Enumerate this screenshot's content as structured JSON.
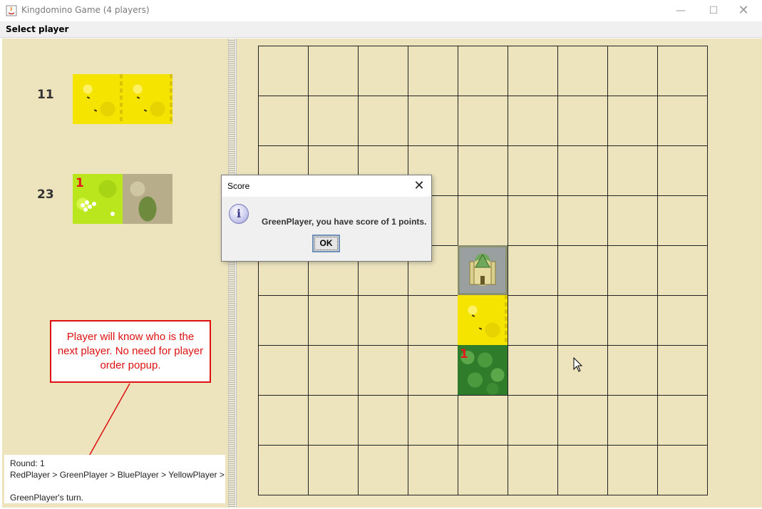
{
  "window": {
    "title": "Kingdomino Game (4 players)",
    "minimize_icon": "minimize-icon",
    "maximize_icon": "maximize-icon",
    "close_icon": "close-icon"
  },
  "menu": {
    "label": "Select player"
  },
  "dominoes": [
    {
      "number": "11",
      "left": "wheat",
      "right": "wheat",
      "crown": ""
    },
    {
      "number": "23",
      "left": "meadow",
      "right": "swamp",
      "crown": "1"
    }
  ],
  "board": {
    "rows": 9,
    "cols": 9,
    "tiles": [
      {
        "row": 4,
        "col": 4,
        "terrain": "castle",
        "crown": ""
      },
      {
        "row": 5,
        "col": 4,
        "terrain": "wheat",
        "crown": ""
      },
      {
        "row": 6,
        "col": 4,
        "terrain": "forest",
        "crown": "1"
      }
    ]
  },
  "status": {
    "round": "Round: 1",
    "order": "RedPlayer > GreenPlayer > BluePlayer > YellowPlayer >",
    "turn": "GreenPlayer's turn."
  },
  "annotation": {
    "text": "Player will know who is the next player. No need for player order popup.",
    "color": "#dd1111"
  },
  "dialog": {
    "title": "Score",
    "message": "GreenPlayer, you have score of 1 points.",
    "ok_label": "OK",
    "icon": "info-icon"
  },
  "colors": {
    "board_background": "#ede4be",
    "crown_red": "#e11a1a"
  }
}
